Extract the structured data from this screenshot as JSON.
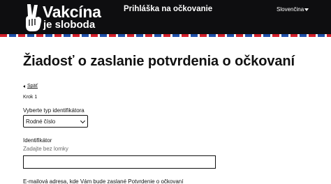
{
  "header": {
    "logo_title": "Vakcína",
    "logo_subtitle": "je sloboda",
    "app_title": "Prihláška na očkovanie",
    "language": "Slovenčina",
    "colors": {
      "background": "#0e0e10",
      "stripe_red": "#d21f2b",
      "stripe_blue": "#1f4fa8"
    }
  },
  "main": {
    "heading": "Žiadosť o zaslanie potvrdenia o očkovaní",
    "back_label": "Späť",
    "step_label": "Krok 1",
    "identifier_type": {
      "label": "Vyberte typ identifikátora",
      "selected": "Rodné číslo"
    },
    "identifier": {
      "label": "Identifikátor",
      "hint": "Zadajte bez lomky",
      "value": ""
    },
    "email_label": "E-mailová adresa, kde Vám bude zaslané Potvrdenie o očkovaní"
  }
}
